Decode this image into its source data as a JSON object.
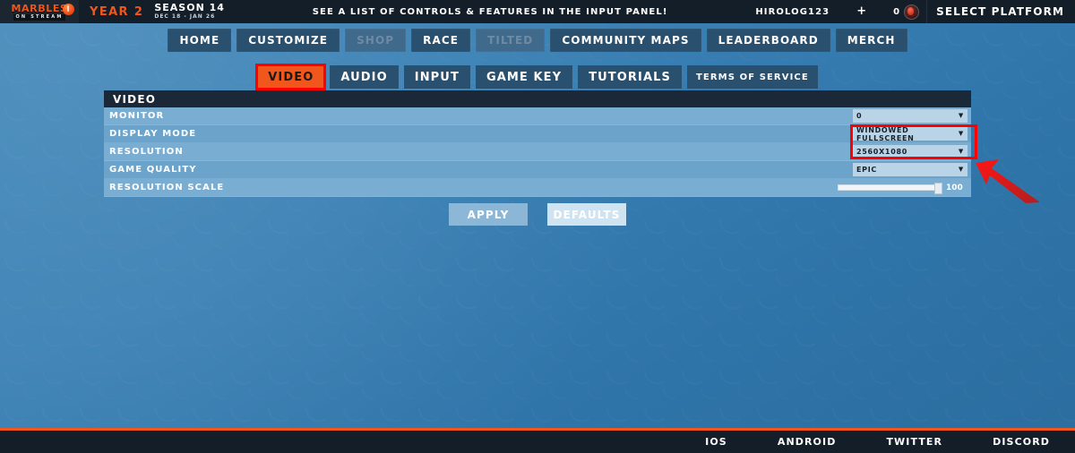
{
  "topbar": {
    "logo_main": "MARBLES",
    "logo_sub": "ON STREAM",
    "year": "YEAR 2",
    "season_title": "SEASON 14",
    "season_dates": "DEC 18 - JAN 26",
    "banner": "SEE A LIST OF CONTROLS & FEATURES IN THE INPUT PANEL!",
    "username": "HIROLOG123",
    "add_label": "+",
    "coin_count": "0",
    "platform_label": "SELECT PLATFORM"
  },
  "nav": {
    "items": [
      {
        "label": "HOME",
        "disabled": false
      },
      {
        "label": "CUSTOMIZE",
        "disabled": false
      },
      {
        "label": "SHOP",
        "disabled": true
      },
      {
        "label": "RACE",
        "disabled": false
      },
      {
        "label": "TILTED",
        "disabled": true
      },
      {
        "label": "COMMUNITY MAPS",
        "disabled": false
      },
      {
        "label": "LEADERBOARD",
        "disabled": false
      },
      {
        "label": "MERCH",
        "disabled": false
      }
    ]
  },
  "tabs": {
    "items": [
      {
        "label": "VIDEO",
        "active": true
      },
      {
        "label": "AUDIO",
        "active": false
      },
      {
        "label": "INPUT",
        "active": false
      },
      {
        "label": "GAME KEY",
        "active": false
      },
      {
        "label": "TUTORIALS",
        "active": false
      },
      {
        "label": "TERMS OF SERVICE",
        "active": false
      }
    ]
  },
  "panel": {
    "title": "VIDEO",
    "rows": [
      {
        "label": "MONITOR",
        "type": "dropdown",
        "value": "0"
      },
      {
        "label": "DISPLAY MODE",
        "type": "dropdown",
        "value": "WINDOWED FULLSCREEN"
      },
      {
        "label": "RESOLUTION",
        "type": "dropdown",
        "value": "2560X1080"
      },
      {
        "label": "GAME QUALITY",
        "type": "dropdown",
        "value": "EPIC"
      },
      {
        "label": "RESOLUTION SCALE",
        "type": "slider",
        "value": "100"
      }
    ]
  },
  "actions": {
    "apply": "APPLY",
    "defaults": "DEFAULTS"
  },
  "footer": {
    "links": [
      "IOS",
      "ANDROID",
      "TWITTER",
      "DISCORD"
    ]
  },
  "colors": {
    "brand_orange": "#f1561c",
    "annotation_red": "#ff0000",
    "panel_blue": "#79aed2",
    "dark": "#141e28"
  }
}
